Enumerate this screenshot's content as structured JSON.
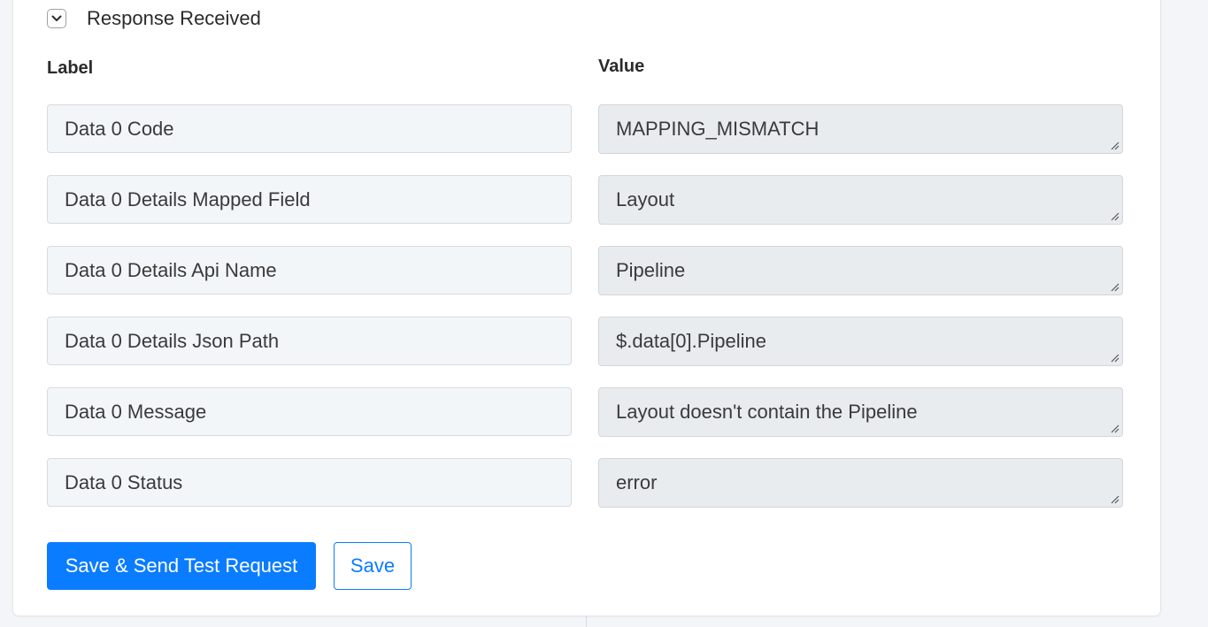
{
  "section": {
    "title": "Response Received",
    "toggle_icon": "chevron-down-icon"
  },
  "columns": {
    "label": "Label",
    "value": "Value"
  },
  "rows": [
    {
      "label": "Data 0 Code",
      "value": "MAPPING_MISMATCH"
    },
    {
      "label": "Data 0 Details Mapped Field",
      "value": "Layout"
    },
    {
      "label": "Data 0 Details Api Name",
      "value": "Pipeline"
    },
    {
      "label": "Data 0 Details Json Path",
      "value": "$.data[0].Pipeline"
    },
    {
      "label": "Data 0 Message",
      "value": "Layout doesn't contain the Pipeline"
    },
    {
      "label": "Data 0 Status",
      "value": "error"
    }
  ],
  "actions": {
    "primary_label": "Save & Send Test Request",
    "secondary_label": "Save"
  },
  "colors": {
    "accent": "#0a7cff",
    "label_field_bg": "#f3f6f9",
    "value_field_bg": "#e9ecef"
  }
}
